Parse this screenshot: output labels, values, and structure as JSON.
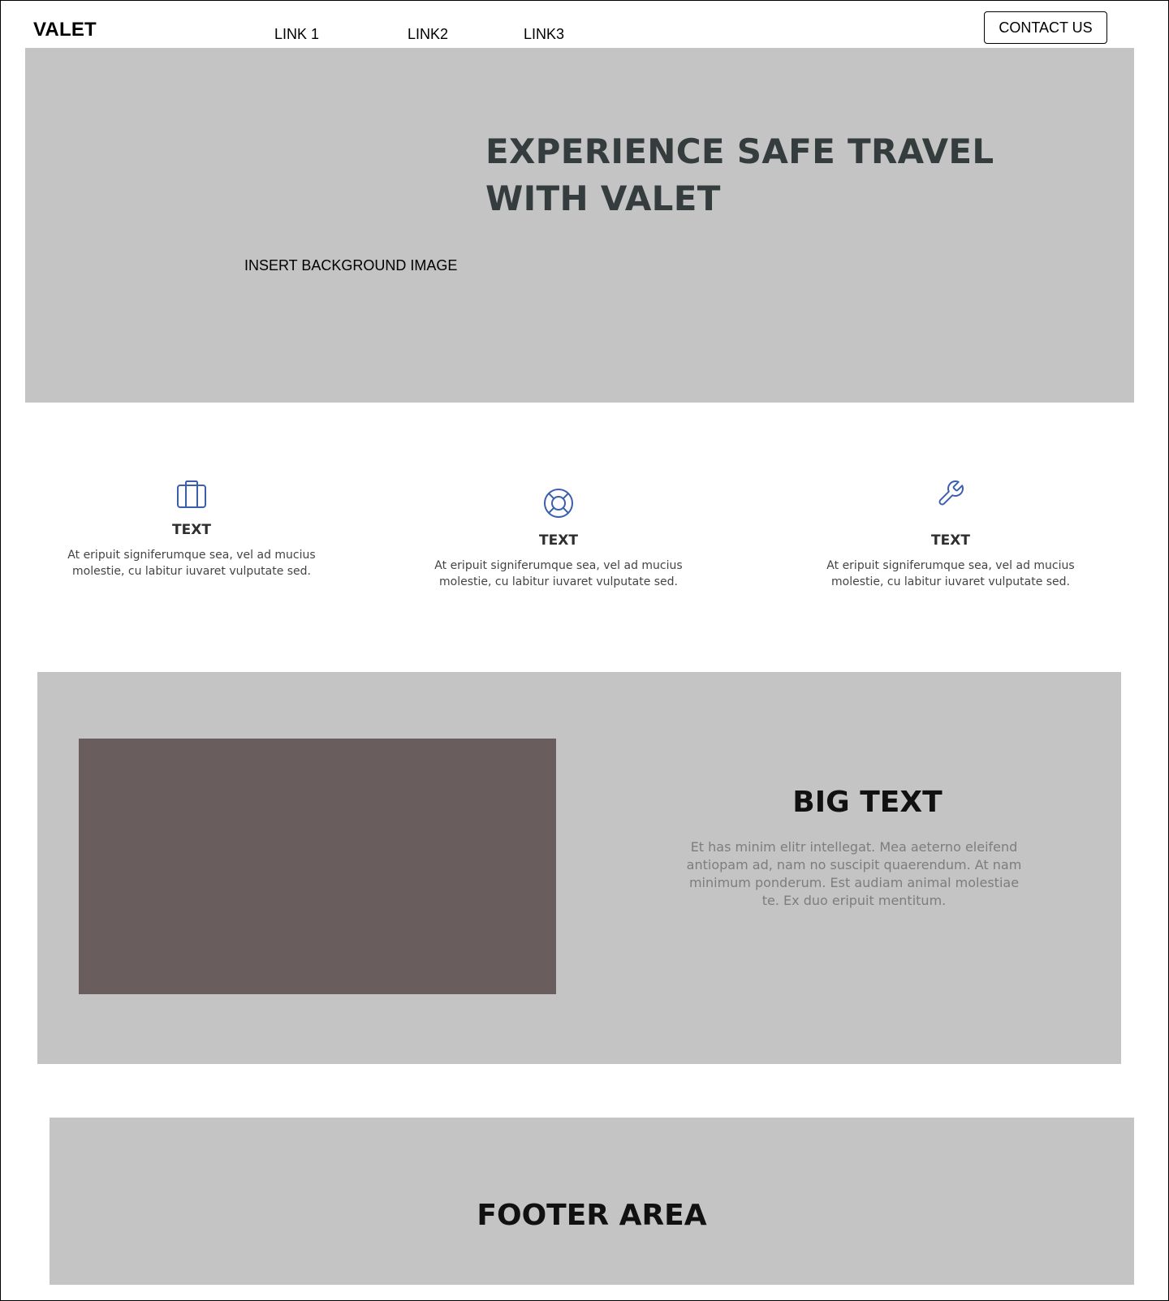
{
  "header": {
    "logo": "VALET",
    "nav": [
      {
        "label": "LINK 1"
      },
      {
        "label": "LINK2"
      },
      {
        "label": "LINK3"
      }
    ],
    "contact_label": "CONTACT US"
  },
  "hero": {
    "title": "EXPERIENCE SAFE TRAVEL WITH VALET",
    "background_placeholder": "INSERT BACKGROUND IMAGE",
    "background_color": "#c4c4c4",
    "title_color": "#353c3e"
  },
  "features": [
    {
      "icon": "briefcase-icon",
      "title": "TEXT",
      "text": "At eripuit signiferumque sea, vel ad mucius molestie, cu labitur iuvaret vulputate sed."
    },
    {
      "icon": "lifebuoy-icon",
      "title": "TEXT",
      "text": "At eripuit signiferumque sea, vel ad mucius molestie, cu labitur iuvaret vulputate sed."
    },
    {
      "icon": "wrench-icon",
      "title": "TEXT",
      "text": "At eripuit signiferumque sea, vel ad mucius molestie, cu labitur iuvaret vulputate sed."
    }
  ],
  "icon_color": "#3b5fad",
  "section": {
    "heading": "BIG TEXT",
    "paragraph": "Et has minim elitr intellegat. Mea aeterno eleifend antiopam ad, nam no suscipit quaerendum. At nam minimum ponderum. Est audiam animal molestiae te. Ex duo eripuit mentitum.",
    "media_color": "#6a5d5d"
  },
  "footer": {
    "label": "FOOTER AREA"
  }
}
